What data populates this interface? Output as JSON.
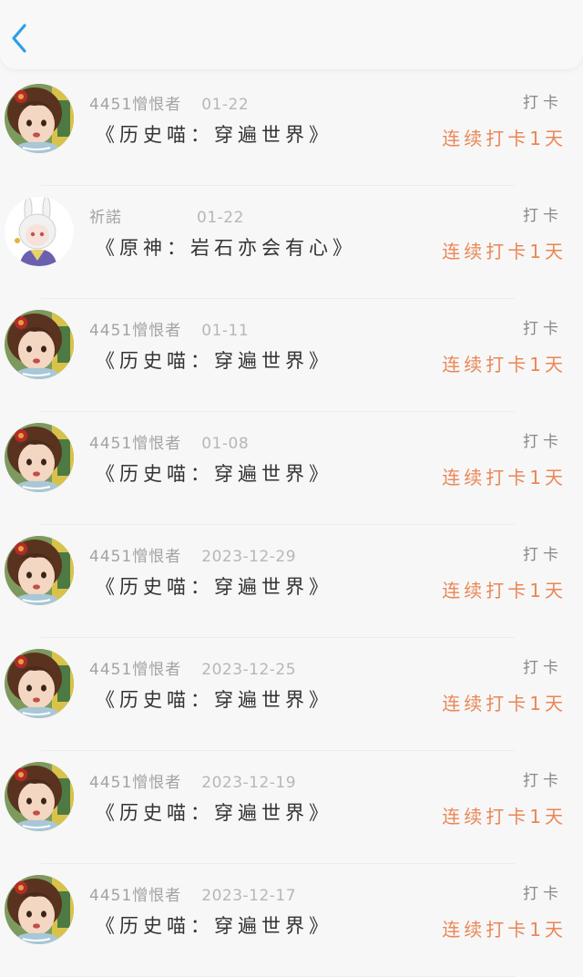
{
  "header": {
    "back_icon": "chevron-left-icon",
    "back_color": "#2aa0e8"
  },
  "entries": [
    {
      "avatar": "girl",
      "user": "4451憎恨者",
      "date": "01-22",
      "title": "《历史喵：穿遍世界》",
      "action": "打卡",
      "streak": "连续打卡1天"
    },
    {
      "avatar": "bunny",
      "user": "祈諾",
      "date": "01-22",
      "title": "《原神：岩石亦会有心》",
      "action": "打卡",
      "streak": "连续打卡1天"
    },
    {
      "avatar": "girl",
      "user": "4451憎恨者",
      "date": "01-11",
      "title": "《历史喵：穿遍世界》",
      "action": "打卡",
      "streak": "连续打卡1天"
    },
    {
      "avatar": "girl",
      "user": "4451憎恨者",
      "date": "01-08",
      "title": "《历史喵：穿遍世界》",
      "action": "打卡",
      "streak": "连续打卡1天"
    },
    {
      "avatar": "girl",
      "user": "4451憎恨者",
      "date": "2023-12-29",
      "title": "《历史喵：穿遍世界》",
      "action": "打卡",
      "streak": "连续打卡1天"
    },
    {
      "avatar": "girl",
      "user": "4451憎恨者",
      "date": "2023-12-25",
      "title": "《历史喵：穿遍世界》",
      "action": "打卡",
      "streak": "连续打卡1天"
    },
    {
      "avatar": "girl",
      "user": "4451憎恨者",
      "date": "2023-12-19",
      "title": "《历史喵：穿遍世界》",
      "action": "打卡",
      "streak": "连续打卡1天"
    },
    {
      "avatar": "girl",
      "user": "4451憎恨者",
      "date": "2023-12-17",
      "title": "《历史喵：穿遍世界》",
      "action": "打卡",
      "streak": "连续打卡1天"
    }
  ],
  "colors": {
    "streak": "#ea8656",
    "accent": "#2aa0e8"
  }
}
